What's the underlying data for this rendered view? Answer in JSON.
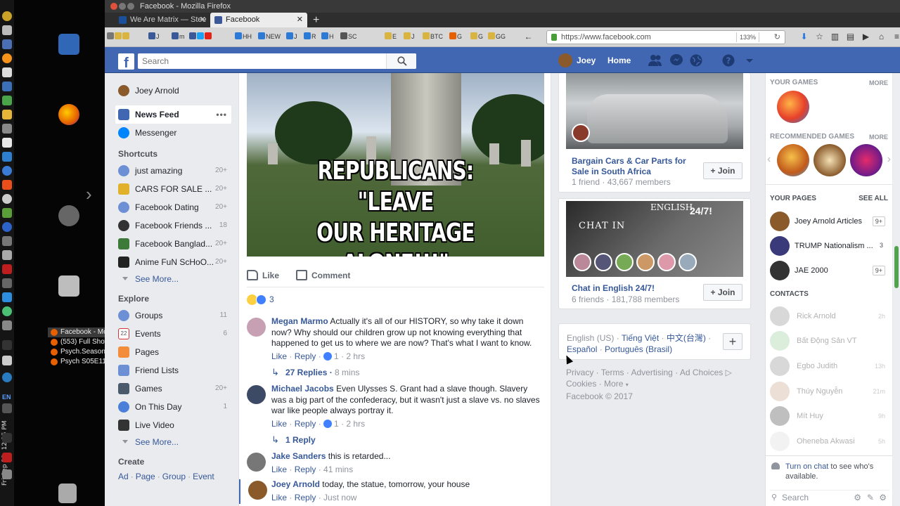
{
  "window": {
    "title": "Facebook - Mozilla Firefox"
  },
  "tabs": [
    {
      "label": "We Are Matrix — Stee",
      "active": false
    },
    {
      "label": "Facebook",
      "active": true
    }
  ],
  "toolbar": {
    "bookmarks": [
      "J",
      "m",
      "HH",
      "NEW",
      "J",
      "R",
      "H",
      "SC",
      "E",
      "J",
      "BTC",
      "G",
      "G",
      "GG"
    ],
    "url": "https://www.facebook.com",
    "zoom": "133%"
  },
  "desktop": {
    "clock": "Fri Sep 22, 12:25 PM",
    "lang": "EN",
    "tasks": [
      "Facebook - Mo...",
      "(553) Full Show...",
      "Psych.Season....",
      "Psych S05E11 - ..."
    ]
  },
  "fb": {
    "search_placeholder": "Search",
    "user_name": "Joey",
    "home_label": "Home",
    "colors": {
      "brand": "#4267b2",
      "link": "#365899"
    }
  },
  "left": {
    "profile": "Joey Arnold",
    "news_feed": "News Feed",
    "news_dots": "•••",
    "messenger": "Messenger",
    "shortcuts_title": "Shortcuts",
    "shortcuts": [
      {
        "label": "just amazing",
        "count": "20+"
      },
      {
        "label": "CARS FOR SALE ...",
        "count": "20+"
      },
      {
        "label": "Facebook Dating",
        "count": "20+"
      },
      {
        "label": "Facebook Friends ...",
        "count": "18"
      },
      {
        "label": "Facebook Banglad...",
        "count": "20+"
      },
      {
        "label": "Anime FuN ScHoO...",
        "count": "20+"
      }
    ],
    "see_more": "See More...",
    "explore_title": "Explore",
    "explore": [
      {
        "label": "Groups",
        "count": "11"
      },
      {
        "label": "Events",
        "count": "6"
      },
      {
        "label": "Pages",
        "count": ""
      },
      {
        "label": "Friend Lists",
        "count": ""
      },
      {
        "label": "Games",
        "count": "20+"
      },
      {
        "label": "On This Day",
        "count": "1"
      },
      {
        "label": "Live Video",
        "count": ""
      }
    ],
    "see_more2": "See More...",
    "create_title": "Create",
    "create": [
      "Ad",
      "Page",
      "Group",
      "Event"
    ]
  },
  "post": {
    "caption_line1": "REPUBLICANS: \"LEAVE",
    "caption_line2": "OUR HERITAGE",
    "caption_line3": "ALONE!!!\"",
    "like_label": "Like",
    "comment_label": "Comment",
    "reaction_count": "3",
    "comments": [
      {
        "name": "Megan Marmo",
        "text": "Actually it's all of our HISTORY, so why take it down now? Why should our children grow up not knowing everything that happened to get us to where we are now? That's what I want to know.",
        "likes": "1",
        "time": "2 hrs"
      },
      {
        "name": "Michael Jacobs",
        "text": "Even Ulysses S. Grant had a slave though. Slavery was a big part of the confederacy, but it wasn't just a slave vs. no slaves war like people always portray it.",
        "likes": "1",
        "time": "2 hrs"
      },
      {
        "name": "Jake Sanders",
        "text": "this is retarded...",
        "likes": "",
        "time": "41 mins"
      },
      {
        "name": "Joey Arnold",
        "text": "today, the statue, tomorrow, your house",
        "likes": "",
        "time": "Just now"
      }
    ],
    "like_link": "Like",
    "reply_link": "Reply",
    "replies1": "27 Replies",
    "replies1_time": "8 mins",
    "replies2": "1 Reply"
  },
  "groups": [
    {
      "title": "Bargain Cars & Car Parts for Sale in South Africa",
      "sub": "1 friend · 43,667 members",
      "join": "Join"
    },
    {
      "title": "Chat in English 24/7!",
      "sub": "6 friends · 181,788 members",
      "join": "Join",
      "img_text1": "CHAT  IN",
      "img_text2": "ENGLISH",
      "img_text3": "24/7!"
    }
  ],
  "languages": {
    "current": "English (US)",
    "others": [
      "Tiếng Việt",
      "中文(台灣)",
      "Español",
      "Português (Brasil)"
    ]
  },
  "footer": {
    "links": [
      "Privacy",
      "Terms",
      "Advertising",
      "Ad Choices",
      "Cookies",
      "More"
    ],
    "copyright": "Facebook © 2017"
  },
  "right": {
    "your_games": "YOUR GAMES",
    "more": "MORE",
    "recommended_games": "RECOMMENDED GAMES",
    "your_pages": "YOUR PAGES",
    "see_all": "SEE ALL",
    "pages": [
      {
        "name": "Joey Arnold Articles",
        "badge": "9+"
      },
      {
        "name": "TRUMP Nationalism ...",
        "badge": "3"
      },
      {
        "name": "JAE 2000",
        "badge": "9+"
      }
    ],
    "contacts_title": "CONTACTS",
    "contacts": [
      {
        "name": "Rick Arnold",
        "time": "2h"
      },
      {
        "name": "Bất Động Sản VT",
        "time": ""
      },
      {
        "name": "Egbo Judith",
        "time": "13h"
      },
      {
        "name": "Thúy Nguyễn",
        "time": "21m"
      },
      {
        "name": "Mít Huy",
        "time": "9h"
      },
      {
        "name": "Oheneba Akwasi",
        "time": "5h"
      }
    ],
    "chat_on_link": "Turn on chat",
    "chat_on_rest": " to see who's available.",
    "chat_search": "Search"
  }
}
